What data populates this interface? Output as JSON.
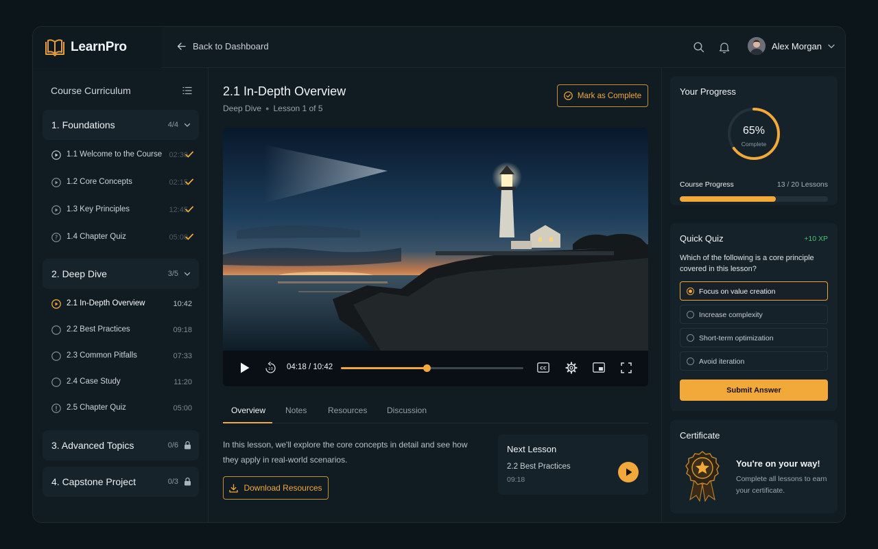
{
  "app": {
    "name": "LearnPro",
    "back_label": "Back to Dashboard",
    "user_name": "Alex Morgan"
  },
  "colors": {
    "accent": "#f3a93a",
    "background": "#101c22",
    "success": "#45c476"
  },
  "sidebar": {
    "title": "Course Curriculum",
    "sections": [
      {
        "label": "1. Foundations",
        "count": "4/4",
        "state": "expanded",
        "lessons": [
          {
            "label": "1.1 Welcome to the Course",
            "time": "02:30",
            "status": "complete"
          },
          {
            "label": "1.2 Core Concepts",
            "time": "02:15",
            "status": "complete"
          },
          {
            "label": "1.3 Key Principles",
            "time": "12:45",
            "status": "complete"
          },
          {
            "label": "1.4 Chapter Quiz",
            "time": "05:00",
            "status": "complete"
          }
        ]
      },
      {
        "label": "2. Deep Dive",
        "count": "3/5",
        "state": "expanded",
        "lessons": [
          {
            "label": "2.1 In-Depth Overview",
            "time": "10:42",
            "status": "current"
          },
          {
            "label": "2.2 Best Practices",
            "time": "09:18",
            "status": "incomplete"
          },
          {
            "label": "2.3 Common Pitfalls",
            "time": "07:33",
            "status": "incomplete"
          },
          {
            "label": "2.4 Case Study",
            "time": "11:20",
            "status": "incomplete"
          },
          {
            "label": "2.5 Chapter Quiz",
            "time": "05:00",
            "status": "incomplete"
          }
        ]
      },
      {
        "label": "3. Advanced Topics",
        "count": "0/6",
        "state": "locked"
      },
      {
        "label": "4. Capstone Project",
        "count": "0/3",
        "state": "locked"
      }
    ]
  },
  "lesson": {
    "title": "2.1 In-Depth Overview",
    "module": "Deep Dive",
    "position": "Lesson 1 of 5",
    "mark_complete_label": "Mark as Complete"
  },
  "player": {
    "current_time": "04:18",
    "separator": "/",
    "duration": "10:42",
    "progress": 0.47
  },
  "tabs": [
    "Overview",
    "Notes",
    "Resources",
    "Discussion"
  ],
  "overview": {
    "text": "In this lesson, we'll explore the core concepts in detail and see how they apply in real-world scenarios.",
    "download_label": "Download Resources"
  },
  "next_lesson": {
    "heading": "Next Lesson",
    "title": "2.2 Best Practices",
    "time": "09:18"
  },
  "progress": {
    "title": "Your Progress",
    "percent_label": "65%",
    "percent_value": 65,
    "percent_sub": "Complete",
    "bar_label": "Course Progress",
    "bar_count": "13 / 20 Lessons",
    "bar_fraction": 0.65
  },
  "quiz": {
    "title": "Quick Quiz",
    "xp": "+10 XP",
    "question": "Which of the following is a core principle covered in this lesson?",
    "options": [
      "Focus on value creation",
      "Increase complexity",
      "Short-term optimization",
      "Avoid iteration"
    ],
    "selected_index": 0,
    "submit_label": "Submit Answer"
  },
  "certificate": {
    "title": "Certificate",
    "heading": "You're on your way!",
    "text": "Complete all lessons to earn your certificate."
  },
  "icons": {
    "logo": "book-icon",
    "back": "arrow-left-icon",
    "search": "search-icon",
    "notify": "bell-icon",
    "menu": "list-icon",
    "play": "play-icon",
    "rewind": "rewind-10-icon",
    "captions": "cc-icon",
    "settings": "gear-icon",
    "pip": "picture-in-picture-icon",
    "fullscreen": "fullscreen-icon",
    "download": "download-icon",
    "lock": "lock-icon",
    "check": "check-icon",
    "award": "medal-icon"
  }
}
